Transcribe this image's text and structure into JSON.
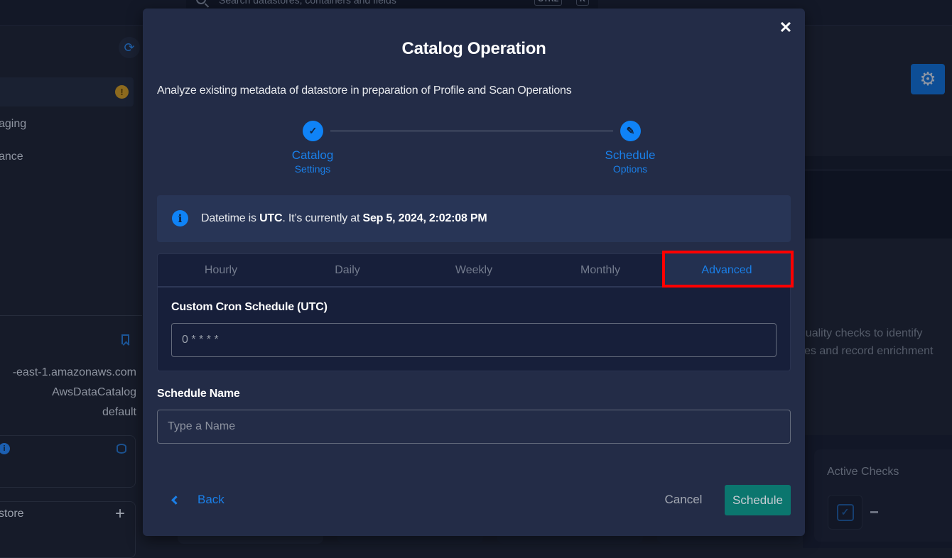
{
  "background": {
    "search": {
      "placeholder": "Search datastores, containers and fields",
      "shortcut_keys": [
        "CTRL",
        "+",
        "K"
      ]
    },
    "sidebar": {
      "items": [
        {
          "label": "aging"
        },
        {
          "label": "ance"
        }
      ],
      "warning_badge": "!",
      "meta": {
        "host": "-east-1.amazonaws.com",
        "catalog": "AwsDataCatalog",
        "database": "default"
      },
      "add_section_label": "store",
      "add_symbol": "+"
    },
    "right_panel": {
      "description_line1": "t quality checks to identify",
      "description_line2": "alies and record enrichment",
      "active_checks_title": "Active Checks",
      "active_checks_value": "–"
    }
  },
  "modal": {
    "title": "Catalog Operation",
    "subtitle": "Analyze existing metadata of datastore in preparation of Profile and Scan Operations",
    "close_symbol": "✕",
    "steps": [
      {
        "label": "Catalog",
        "sublabel": "Settings",
        "icon": "check-icon",
        "glyph": "✓",
        "status": "completed"
      },
      {
        "label": "Schedule",
        "sublabel": "Options",
        "icon": "pencil-icon",
        "glyph": "✎",
        "status": "active"
      }
    ],
    "info_banner": {
      "prefix": "Datetime is ",
      "timezone": "UTC",
      "middle": ". It’s currently at ",
      "current_datetime": "Sep 5, 2024, 2:02:08 PM"
    },
    "tabs": [
      {
        "label": "Hourly",
        "active": false
      },
      {
        "label": "Daily",
        "active": false
      },
      {
        "label": "Weekly",
        "active": false
      },
      {
        "label": "Monthly",
        "active": false
      },
      {
        "label": "Advanced",
        "active": true
      }
    ],
    "cron": {
      "label": "Custom Cron Schedule (UTC)",
      "value": "0 * * * *"
    },
    "schedule_name": {
      "label": "Schedule Name",
      "value": "",
      "placeholder": "Type a Name"
    },
    "footer": {
      "back_label": "Back",
      "cancel_label": "Cancel",
      "schedule_label": "Schedule"
    }
  },
  "colors": {
    "accent_blue": "#0f83f7",
    "schedule_button": "#0b766e",
    "highlight_box": "#ff0000",
    "modal_bg": "#232c47"
  }
}
